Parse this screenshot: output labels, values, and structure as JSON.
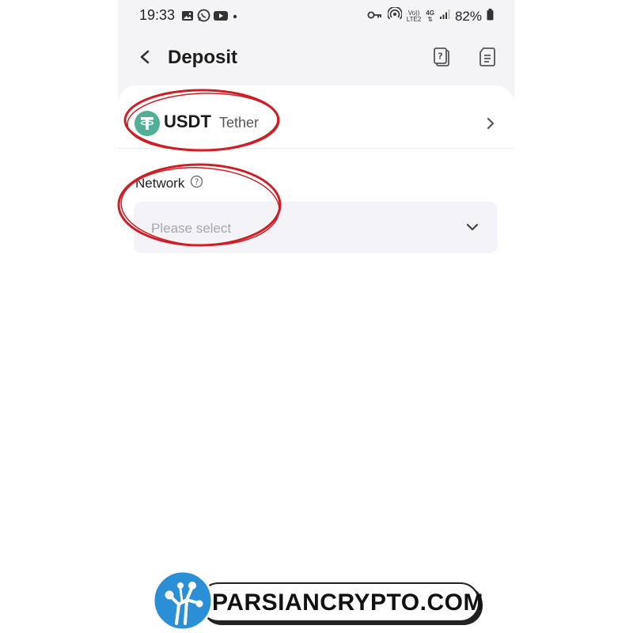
{
  "status_bar": {
    "time": "19:33",
    "volte_label": "Vo))",
    "lte_label": "LTE2",
    "network_type": "4G",
    "battery": "82%"
  },
  "header": {
    "title": "Deposit",
    "back_icon": "chevron-left-icon",
    "help_doc_icon": "question-document-icon",
    "records_icon": "document-list-icon"
  },
  "coin": {
    "symbol": "USDT",
    "name": "Tether",
    "logo_color": "#50af95"
  },
  "network": {
    "label": "Network",
    "placeholder": "Please select"
  },
  "annotation_color": "#cc1f27",
  "watermark": {
    "text": "PARSIANCRYPTO.COM",
    "accent": "#2b8fd6"
  }
}
